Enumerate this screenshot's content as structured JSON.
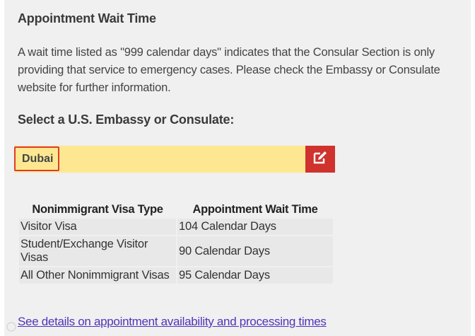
{
  "panel": {
    "title": "Appointment Wait Time",
    "description": "A wait time listed as \"999 calendar days\" indicates that the Consular Section is only providing that service to emergency cases.  Please check the Embassy or Consulate website for further information.",
    "select_label": "Select a U.S. Embassy or Consulate:",
    "selected_post": "Dubai",
    "edit_icon": "edit-icon",
    "accent_color": "#d0322d",
    "selector_color": "#fde891"
  },
  "table": {
    "headers": [
      "Nonimmigrant Visa Type",
      "Appointment Wait Time"
    ],
    "rows": [
      {
        "type": "Visitor Visa",
        "wait": "104 Calendar Days"
      },
      {
        "type": "Student/Exchange Visitor Visas",
        "wait": "90 Calendar Days"
      },
      {
        "type": "All Other Nonimmigrant Visas",
        "wait": "95 Calendar Days"
      }
    ]
  },
  "link": {
    "label": "See details on appointment availability and processing times"
  }
}
